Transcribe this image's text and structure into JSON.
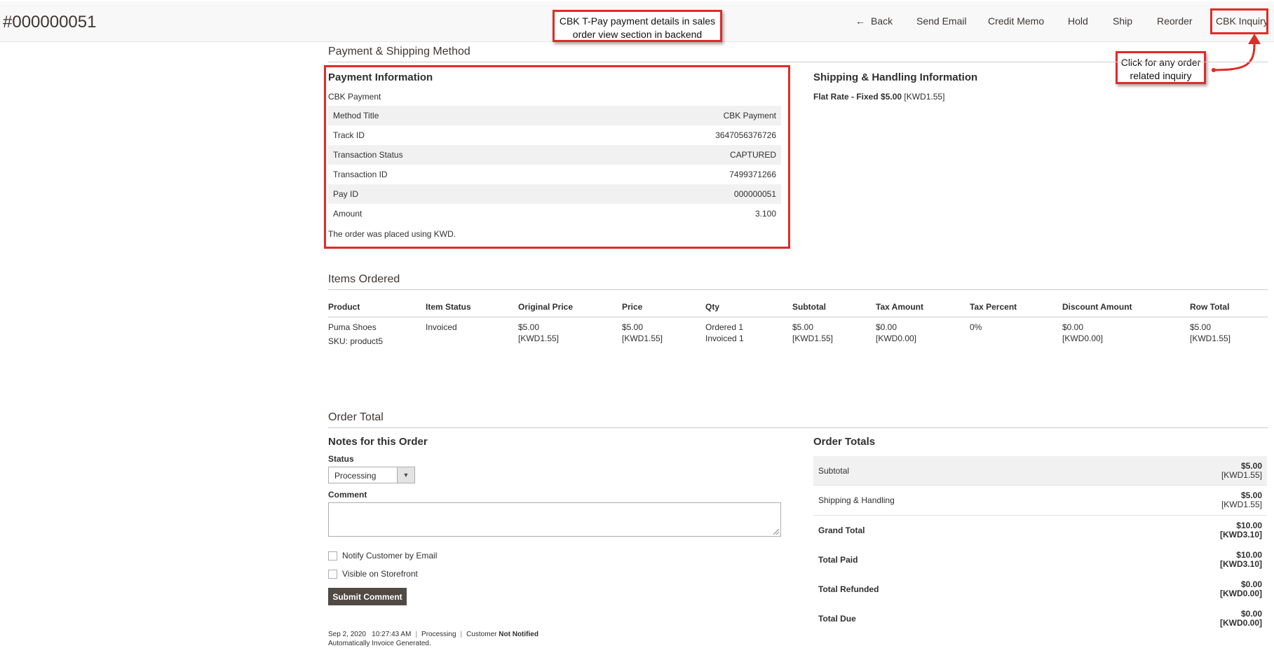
{
  "header": {
    "order_number": "#000000051",
    "buttons": {
      "back": "Back",
      "send_email": "Send Email",
      "credit_memo": "Credit Memo",
      "hold": "Hold",
      "ship": "Ship",
      "reorder": "Reorder",
      "cbk_inquiry": "CBK Inquiry"
    }
  },
  "annotations": {
    "payment_callout_line1": "CBK T-Pay payment details in sales",
    "payment_callout_line2": "order view section in backend",
    "inquiry_callout_line1": "Click for any order",
    "inquiry_callout_line2": "related inquiry",
    "highlight_color": "#e02b27"
  },
  "payment_shipping": {
    "section_title": "Payment & Shipping Method",
    "payment": {
      "title": "Payment Information",
      "method_name": "CBK Payment",
      "rows": [
        {
          "label": "Method Title",
          "value": "CBK Payment"
        },
        {
          "label": "Track ID",
          "value": "3647056376726"
        },
        {
          "label": "Transaction Status",
          "value": "CAPTURED"
        },
        {
          "label": "Transaction ID",
          "value": "7499371266"
        },
        {
          "label": "Pay ID",
          "value": "000000051"
        },
        {
          "label": "Amount",
          "value": "3.100"
        }
      ],
      "currency_note": "The order was placed using KWD."
    },
    "shipping": {
      "title": "Shipping & Handling Information",
      "method": "Flat Rate - Fixed $5.00",
      "method_converted": "[KWD1.55]"
    }
  },
  "items": {
    "section_title": "Items Ordered",
    "columns": {
      "product": "Product",
      "item_status": "Item Status",
      "original_price": "Original Price",
      "price": "Price",
      "qty": "Qty",
      "subtotal": "Subtotal",
      "tax_amount": "Tax Amount",
      "tax_percent": "Tax Percent",
      "discount_amount": "Discount Amount",
      "row_total": "Row Total"
    },
    "rows": [
      {
        "product": "Puma Shoes",
        "sku": "SKU: product5",
        "item_status": "Invoiced",
        "original_price": "$5.00",
        "original_price_converted": "[KWD1.55]",
        "price": "$5.00",
        "price_converted": "[KWD1.55]",
        "qty_ordered": "Ordered 1",
        "qty_invoiced": "Invoiced 1",
        "subtotal": "$5.00",
        "subtotal_converted": "[KWD1.55]",
        "tax_amount": "$0.00",
        "tax_amount_converted": "[KWD0.00]",
        "tax_percent": "0%",
        "discount_amount": "$0.00",
        "discount_amount_converted": "[KWD0.00]",
        "row_total": "$5.00",
        "row_total_converted": "[KWD1.55]"
      }
    ]
  },
  "order_total": {
    "section_title": "Order Total",
    "notes": {
      "title": "Notes for this Order",
      "status_label": "Status",
      "status_value": "Processing",
      "comment_label": "Comment",
      "comment_value": "",
      "notify_label": "Notify Customer by Email",
      "visible_label": "Visible on Storefront",
      "submit_label": "Submit Comment",
      "history": {
        "date": "Sep 2, 2020",
        "time": "10:27:43 AM",
        "status": "Processing",
        "customer_label": "Customer",
        "customer_state": "Not Notified",
        "comment": "Automatically Invoice Generated."
      }
    },
    "totals": {
      "title": "Order Totals",
      "rows": [
        {
          "label": "Subtotal",
          "value": "$5.00",
          "converted": "[KWD1.55]"
        },
        {
          "label": "Shipping & Handling",
          "value": "$5.00",
          "converted": "[KWD1.55]"
        },
        {
          "label": "Grand Total",
          "value": "$10.00",
          "converted": "[KWD3.10]"
        },
        {
          "label": "Total Paid",
          "value": "$10.00",
          "converted": "[KWD3.10]"
        },
        {
          "label": "Total Refunded",
          "value": "$0.00",
          "converted": "[KWD0.00]"
        },
        {
          "label": "Total Due",
          "value": "$0.00",
          "converted": "[KWD0.00]"
        }
      ]
    }
  }
}
